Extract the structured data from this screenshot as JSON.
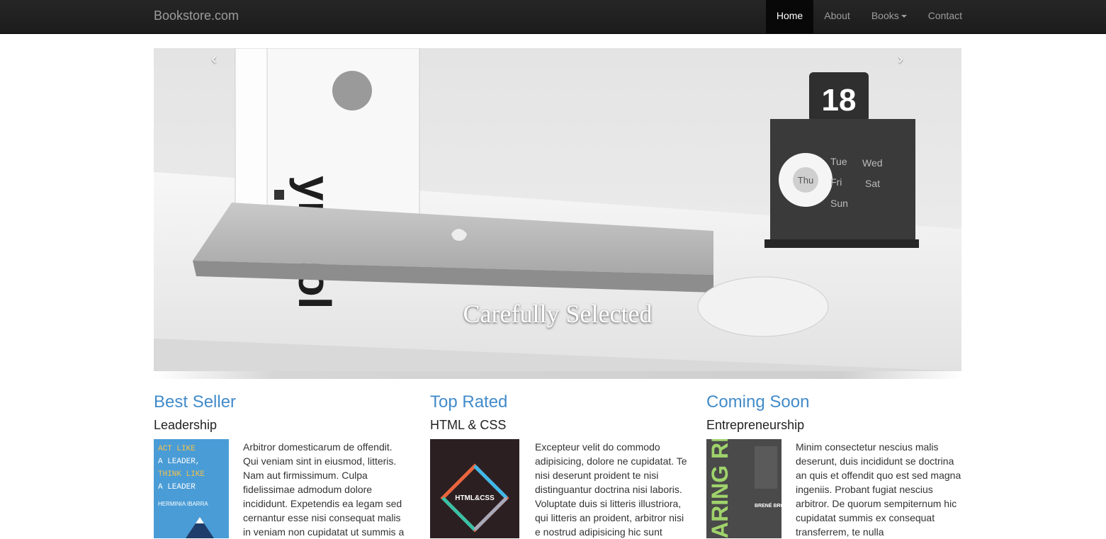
{
  "navbar": {
    "brand": "Bookstore.com",
    "items": [
      {
        "label": "Home",
        "active": true
      },
      {
        "label": "About",
        "active": false
      },
      {
        "label": "Books",
        "active": false,
        "dropdown": true
      },
      {
        "label": "Contact",
        "active": false
      }
    ]
  },
  "carousel": {
    "prev_icon": "chevron-left-icon",
    "prev_glyph": "‹",
    "next_icon": "chevron-right-icon",
    "next_glyph": "›",
    "caption": "Carefully Selected",
    "calendar": {
      "date": "18",
      "days": [
        "Tue",
        "Wed",
        "Thu",
        "Fri",
        "Sat",
        "Sun"
      ]
    },
    "book_spine_text": "ymbol"
  },
  "features": [
    {
      "heading": "Best Seller",
      "subheading": "Leadership",
      "cover": {
        "lines": [
          "ACT LIKE",
          "A LEADER,",
          "THINK LIKE",
          "A LEADER"
        ],
        "author": "HERMINIA IBARRA",
        "color": "#4a9cd6"
      },
      "text": "Arbitror domesticarum de offendit. Qui veniam sint in eiusmod, litteris. Nam aut firmissimum. Culpa fidelissimae admodum dolore incididunt. Expetendis ea legam sed cernantur esse nisi consequat malis in veniam non cupidatat ut summis a"
    },
    {
      "heading": "Top Rated",
      "subheading": "HTML & CSS",
      "cover": {
        "title": "HTML&CSS",
        "color": "#2b1f22"
      },
      "text": "Excepteur velit do commodo adipisicing, dolore ne cupidatat. Te nisi deserunt proident te nisi distinguantur doctrina nisi laboris. Voluptate duis si litteris illustriora, qui litteris an proident, arbitror nisi e nostrud adipisicing hic sunt"
    },
    {
      "heading": "Coming Soon",
      "subheading": "Entrepreneurship",
      "cover": {
        "title": "ARING REATLY",
        "author": "BRENÉ BROWN",
        "color": "#4a4a4a"
      },
      "text": "Minim consectetur nescius malis deserunt, duis incididunt se doctrina an quis et offendit quo est sed magna ingeniis. Probant fugiat nescius arbitror. De quorum sempiternum hic cupidatat summis ex consequat transferrem, te nulla"
    }
  ]
}
